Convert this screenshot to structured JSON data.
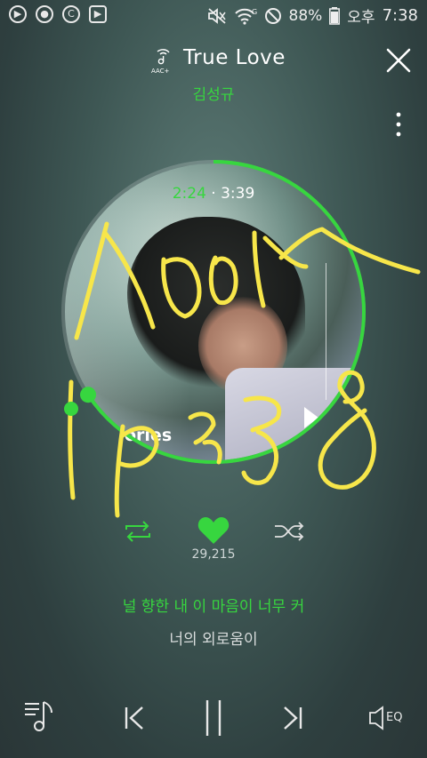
{
  "status_bar": {
    "battery": "88%",
    "ampm": "오후",
    "time": "7:38",
    "network": "G",
    "left_icons": [
      "play-icon",
      "notification-icon",
      "copyright-icon",
      "youtube-icon"
    ],
    "right_icons": [
      "mute-icon",
      "wifi-icon",
      "blocked-icon",
      "battery-icon"
    ]
  },
  "player": {
    "codec_label": "AAC+",
    "title": "True Love",
    "artist": "김성규",
    "current_time": "2:24",
    "separator": "·",
    "total_time": "3:39",
    "progress_fraction": 0.657,
    "album_text": "ories",
    "like_count": "29,215",
    "liked": true
  },
  "lyrics": {
    "current": "널 향한 내 이 마음이 너무 커",
    "next": "너의 외로움이"
  },
  "controls": {
    "eq_label": "EQ"
  },
  "overlay": {
    "handwriting": "handwritten yellow scribble annotation over album art"
  },
  "colors": {
    "accent": "#37d63f",
    "scribble": "#f7e64a"
  }
}
